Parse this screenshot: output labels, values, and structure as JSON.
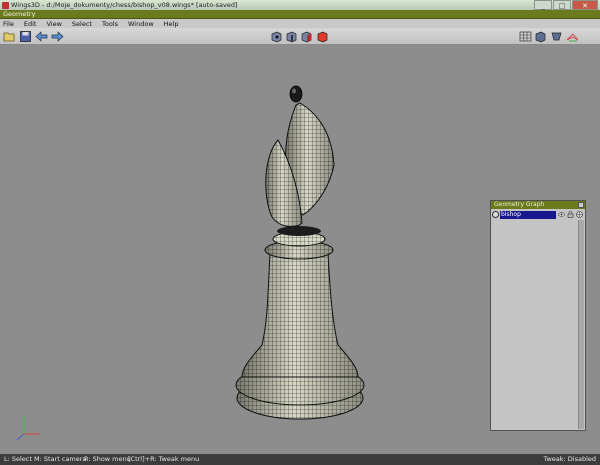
{
  "window": {
    "title": "Wings3D - d:/Moje_dokumenty/chess/bishop_v08.wings* [auto-saved]",
    "minimize": "_",
    "maximize": "□",
    "close": "✕"
  },
  "geometry_bar": {
    "label": "Geometry"
  },
  "menubar": {
    "items": [
      "File",
      "Edit",
      "View",
      "Select",
      "Tools",
      "Window",
      "Help"
    ]
  },
  "toolbar": {
    "left": [
      "open-folder-icon",
      "save-disk-icon",
      "undo-arrow-icon",
      "redo-arrow-icon"
    ],
    "center": [
      "vertex-mode-icon",
      "edge-mode-icon",
      "face-mode-icon",
      "body-mode-icon"
    ],
    "right": [
      "wireframe-toggle-icon",
      "smooth-shading-icon",
      "perspective-toggle-icon",
      "grid-toggle-icon"
    ],
    "active_select_mode": "body",
    "active_color": "#e03a2e"
  },
  "geometry_graph": {
    "title": "Geometry Graph",
    "objects": [
      {
        "name": "bishop"
      }
    ]
  },
  "statusbar": {
    "hints": [
      "L: Select",
      "M: Start camera",
      "R: Show menu",
      "[Ctrl]+R: Tweak menu"
    ],
    "right": "Tweak: Disabled"
  },
  "colors": {
    "geometry_bar": "#6a7a1c",
    "selection_blue": "#17178f",
    "viewport_bg": "#8d8d8d",
    "model_fill": "#d6d6c4",
    "wire": "#1a1a1a"
  }
}
